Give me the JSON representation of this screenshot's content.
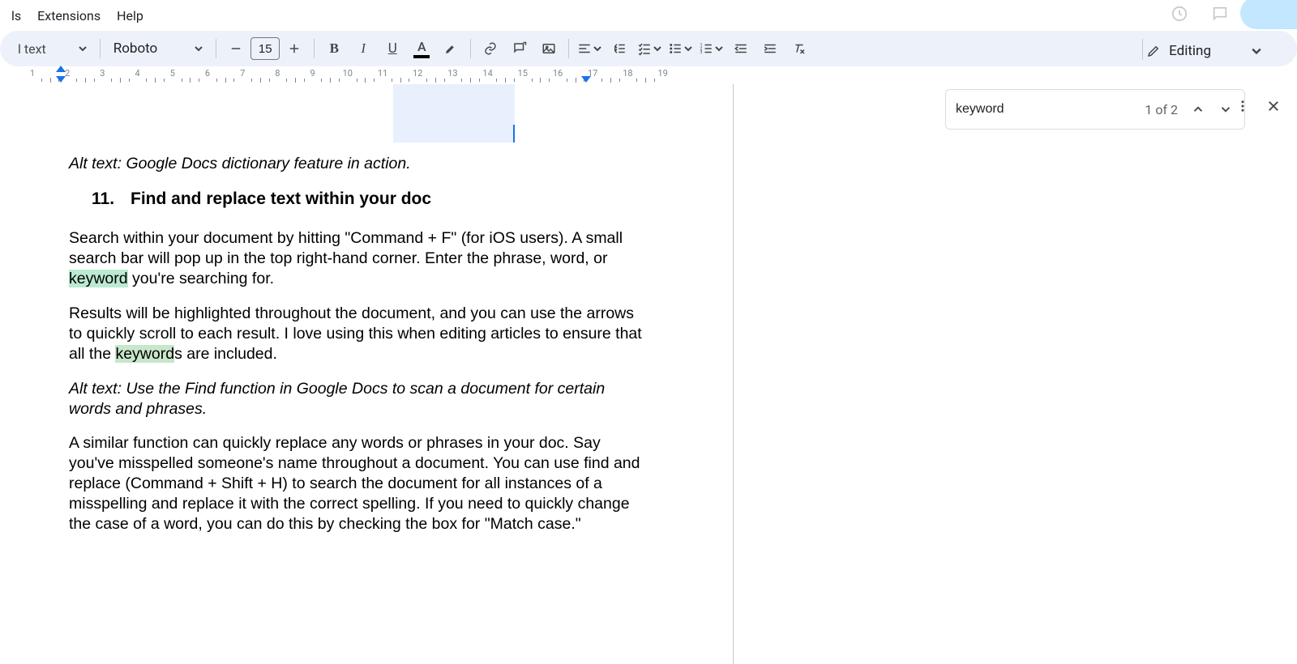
{
  "menu": {
    "items": [
      "ls",
      "Extensions",
      "Help"
    ]
  },
  "toolbar": {
    "style_label": "l text",
    "font_label": "Roboto",
    "font_size": "15",
    "editing_label": "Editing"
  },
  "ruler": {
    "start": 1,
    "end": 19,
    "indent_left_cm": 1.8,
    "indent_right_cm": 16.8
  },
  "find": {
    "query": "keyword",
    "count_label": "1 of 2"
  },
  "doc": {
    "alt1": "Alt text: Google Docs dictionary feature in action.",
    "heading_num": "11.",
    "heading_text": "Find and replace text within your doc",
    "p1a": "Search within your document by hitting \"Command + F\" (for iOS users). A small search bar will pop up in the top right-hand corner. Enter the phrase, word, or ",
    "p1_hl": "keyword",
    "p1b": " you're searching for.",
    "p2a": "Results will be highlighted throughout the document, and you can use the arrows to quickly scroll to each result. I love using this when editing articles to ensure that all the ",
    "p2_hl": "keyword",
    "p2b": "s are included.",
    "alt2": "Alt text: Use the Find function in Google Docs to scan a document for certain words and phrases.",
    "p3": "A similar function can quickly replace any words or phrases in your doc. Say you've misspelled someone's name throughout a document. You can use find and replace (Command + Shift + H) to search the document for all instances of a misspelling and replace it with the correct spelling. If you need to quickly change the case of a word, you can do this by checking the box for \"Match case.\""
  }
}
